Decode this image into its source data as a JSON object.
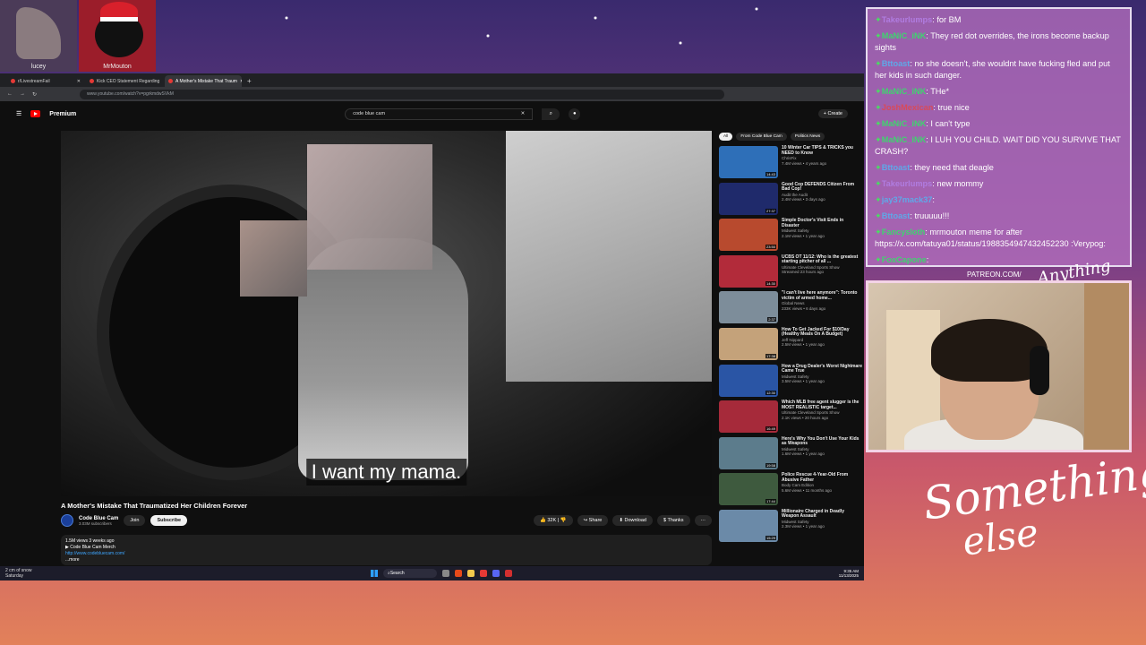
{
  "overlay": {
    "avatars": [
      {
        "name": "lucey"
      },
      {
        "name": "MrMouton"
      }
    ],
    "patreon_label": "PATREON.COM/",
    "brand_small": "Anything else",
    "brand_line1": "Something",
    "brand_line2": "else"
  },
  "browser": {
    "tabs": [
      {
        "label": "r/LivestreamFail"
      },
      {
        "label": "Kick CEO Statement Regarding"
      },
      {
        "label": "A Mother's Mistake That Traum"
      }
    ],
    "url": "www.youtube.com/watch?v=pgrkmdwSVkM"
  },
  "youtube": {
    "logo_label": "Premium",
    "search_value": "code blue cam",
    "create_label": "Create",
    "subtitle": "I want my mama.",
    "video_title": "A Mother's Mistake That Traumatized Her Children Forever",
    "channel_name": "Code Blue Cam",
    "subscribers": "3.03M subscribers",
    "join_label": "Join",
    "subscribe_label": "Subscribe",
    "likes": "32K",
    "share_label": "Share",
    "download_label": "Download",
    "thanks_label": "Thanks",
    "desc_meta": "1.5M views  3 weeks ago",
    "desc_line": "▶ Code Blue Cam Merch",
    "desc_link": "http://www.codebluecam.com/",
    "desc_more": "...more",
    "chips": [
      "All",
      "From Code Blue Cam",
      "Politics News"
    ],
    "recommendations": [
      {
        "title": "10 Winter Car TIPS & TRICKS you NEED to Know",
        "channel": "ChrisFix",
        "meta": "7.4M views • 4 years ago",
        "duration": "14:43",
        "color": "#2e6fb8"
      },
      {
        "title": "Good Cop DEFENDS Citizen From Bad Cop!",
        "channel": "Audit the Audit",
        "meta": "2.4M views • 3 days ago",
        "duration": "27:37",
        "color": "#1f2a6b"
      },
      {
        "title": "Simple Doctor's Visit Ends in Disaster",
        "channel": "Midwest Safety",
        "meta": "2.1M views • 1 year ago",
        "duration": "23:50",
        "color": "#b84a2e"
      },
      {
        "title": "UCBS OT 11/12: Who is the greatest starting pitcher of all ...",
        "channel": "Ultimate Cleveland Sports Show",
        "meta": "Streamed 23 hours ago",
        "duration": "14:30",
        "color": "#b22b3a"
      },
      {
        "title": "\"I can't live here anymore\": Toronto victim of armed home...",
        "channel": "Global News",
        "meta": "233K views • 6 days ago",
        "duration": "2:37",
        "color": "#7d8d9a"
      },
      {
        "title": "How To Get Jacked For $10/Day (Healthy Meals On A Budget)",
        "channel": "Jeff Nippard",
        "meta": "2.5M views • 1 year ago",
        "duration": "17:38",
        "color": "#c4a27a"
      },
      {
        "title": "How a Drug Dealer's Worst Nightmare Came True",
        "channel": "Midwest Safety",
        "meta": "3.5M views • 1 year ago",
        "duration": "12:30",
        "color": "#2a55a5"
      },
      {
        "title": "Which MLB free agent slugger is the MOST REALISTIC target...",
        "channel": "Ultimate Cleveland Sports Show",
        "meta": "2.1K views • 20 hours ago",
        "duration": "16:49",
        "color": "#a62a3a"
      },
      {
        "title": "Here's Why You Don't Use Your Kids as Weapons",
        "channel": "Midwest Safety",
        "meta": "1.6M views • 1 year ago",
        "duration": "19:58",
        "color": "#5c7c8c"
      },
      {
        "title": "Police Rescue 4-Year-Old From Abusive Father",
        "channel": "Body Cam Edition",
        "meta": "5.6M views • 11 months ago",
        "duration": "17:44",
        "color": "#3e5a3e"
      },
      {
        "title": "Millionaire Charged in Deadly Weapon Assault",
        "channel": "Midwest Safety",
        "meta": "2.3M views • 1 year ago",
        "duration": "15:29",
        "color": "#6b8aa8"
      }
    ]
  },
  "taskbar": {
    "weather_line1": "2 cm of snow",
    "weather_line2": "Saturday",
    "search_label": "Search",
    "time": "9:35 AM",
    "date": "11/13/2025"
  },
  "chat": {
    "messages": [
      {
        "user": "Takeurlumps",
        "text": "for BM",
        "color": "#b07ce0"
      },
      {
        "user": "MaNiC_iNK",
        "text": "They red dot overrides, the irons become backup sights",
        "color": "#3fd46f"
      },
      {
        "user": "Bttoast",
        "text": "no she doesn't, she wouldnt have fucking fled and put her kids in such danger.",
        "color": "#5fa8e8"
      },
      {
        "user": "MaNiC_iNK",
        "text": "THe*",
        "color": "#3fd46f"
      },
      {
        "user": "JoshMexican",
        "text": "true nice",
        "color": "#d84a5a"
      },
      {
        "user": "MaNiC_iNK",
        "text": "I can't type",
        "color": "#3fd46f"
      },
      {
        "user": "MaNiC_iNK",
        "text": "I LUH YOU CHILD. WAIT DID YOU SURVIVE THAT CRASH?",
        "color": "#3fd46f"
      },
      {
        "user": "Bttoast",
        "text": "they need that deagle",
        "color": "#5fa8e8"
      },
      {
        "user": "Takeurlumps",
        "text": "new mommy",
        "color": "#b07ce0"
      },
      {
        "user": "jay37mack37",
        "text": "",
        "color": "#5fa8e8"
      },
      {
        "user": "Bttoast",
        "text": "truuuuu!!!",
        "color": "#5fa8e8"
      },
      {
        "user": "Fancysloth",
        "text": "mrmouton meme for after https://x.com/tatuya01/status/1988354947432452230 :Verypog:",
        "color": "#3fd46f"
      },
      {
        "user": "FoxCapone",
        "text": "",
        "color": "#3fd46f"
      }
    ]
  }
}
